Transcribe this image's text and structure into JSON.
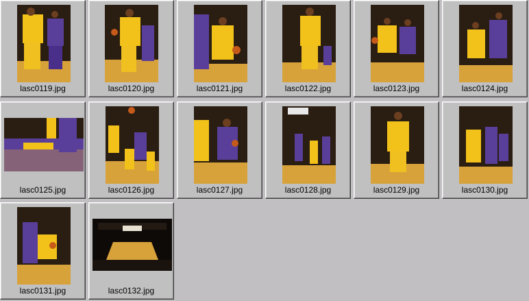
{
  "thumbnails": [
    {
      "filename": "lasc0119.jpg",
      "scene": "court-two-players"
    },
    {
      "filename": "lasc0120.jpg",
      "scene": "court-two-players"
    },
    {
      "filename": "lasc0121.jpg",
      "scene": "court-two-players"
    },
    {
      "filename": "lasc0122.jpg",
      "scene": "court-one-player"
    },
    {
      "filename": "lasc0123.jpg",
      "scene": "court-two-players"
    },
    {
      "filename": "lasc0124.jpg",
      "scene": "court-two-players"
    },
    {
      "filename": "lasc0125.jpg",
      "scene": "player-on-floor"
    },
    {
      "filename": "lasc0126.jpg",
      "scene": "court-group"
    },
    {
      "filename": "lasc0127.jpg",
      "scene": "court-two-players"
    },
    {
      "filename": "lasc0128.jpg",
      "scene": "court-group"
    },
    {
      "filename": "lasc0129.jpg",
      "scene": "court-one-player"
    },
    {
      "filename": "lasc0130.jpg",
      "scene": "court-group"
    },
    {
      "filename": "lasc0131.jpg",
      "scene": "court-two-players"
    },
    {
      "filename": "lasc0132.jpg",
      "scene": "arena-wide"
    }
  ],
  "colors": {
    "background": "#c2bfc2",
    "jersey_gold": "#f2c21a",
    "jersey_purple": "#5a3f9a",
    "court_wood": "#d8a23a"
  }
}
